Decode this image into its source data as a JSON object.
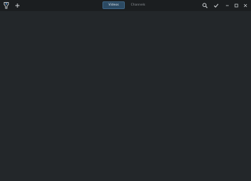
{
  "header": {
    "tabs": [
      {
        "label": "Videos",
        "active": true
      },
      {
        "label": "Channels",
        "active": false
      }
    ],
    "icons": {
      "app": "app-logo-icon",
      "add": "plus-icon",
      "search": "search-icon",
      "select": "checkmark-icon",
      "minimize": "minimize-icon",
      "maximize": "maximize-icon",
      "close": "close-icon"
    }
  },
  "colors": {
    "background": "#23272a",
    "headerbar": "#1b1e20",
    "active_tab": "#2c4a63"
  }
}
